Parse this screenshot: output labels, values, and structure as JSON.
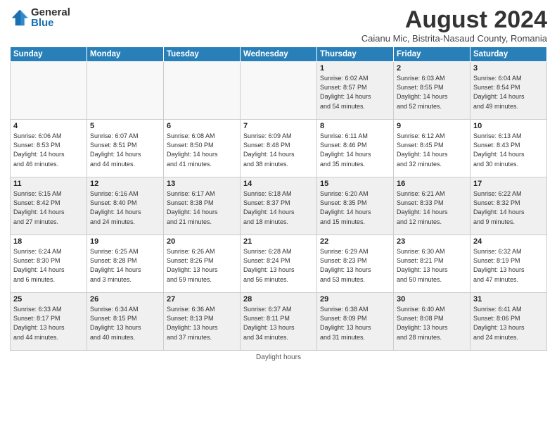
{
  "header": {
    "logo_general": "General",
    "logo_blue": "Blue",
    "month_title": "August 2024",
    "location": "Caianu Mic, Bistrita-Nasaud County, Romania"
  },
  "footer": {
    "daylight_label": "Daylight hours"
  },
  "weekdays": [
    "Sunday",
    "Monday",
    "Tuesday",
    "Wednesday",
    "Thursday",
    "Friday",
    "Saturday"
  ],
  "weeks": [
    [
      {
        "day": "",
        "info": ""
      },
      {
        "day": "",
        "info": ""
      },
      {
        "day": "",
        "info": ""
      },
      {
        "day": "",
        "info": ""
      },
      {
        "day": "1",
        "info": "Sunrise: 6:02 AM\nSunset: 8:57 PM\nDaylight: 14 hours\nand 54 minutes."
      },
      {
        "day": "2",
        "info": "Sunrise: 6:03 AM\nSunset: 8:55 PM\nDaylight: 14 hours\nand 52 minutes."
      },
      {
        "day": "3",
        "info": "Sunrise: 6:04 AM\nSunset: 8:54 PM\nDaylight: 14 hours\nand 49 minutes."
      }
    ],
    [
      {
        "day": "4",
        "info": "Sunrise: 6:06 AM\nSunset: 8:53 PM\nDaylight: 14 hours\nand 46 minutes."
      },
      {
        "day": "5",
        "info": "Sunrise: 6:07 AM\nSunset: 8:51 PM\nDaylight: 14 hours\nand 44 minutes."
      },
      {
        "day": "6",
        "info": "Sunrise: 6:08 AM\nSunset: 8:50 PM\nDaylight: 14 hours\nand 41 minutes."
      },
      {
        "day": "7",
        "info": "Sunrise: 6:09 AM\nSunset: 8:48 PM\nDaylight: 14 hours\nand 38 minutes."
      },
      {
        "day": "8",
        "info": "Sunrise: 6:11 AM\nSunset: 8:46 PM\nDaylight: 14 hours\nand 35 minutes."
      },
      {
        "day": "9",
        "info": "Sunrise: 6:12 AM\nSunset: 8:45 PM\nDaylight: 14 hours\nand 32 minutes."
      },
      {
        "day": "10",
        "info": "Sunrise: 6:13 AM\nSunset: 8:43 PM\nDaylight: 14 hours\nand 30 minutes."
      }
    ],
    [
      {
        "day": "11",
        "info": "Sunrise: 6:15 AM\nSunset: 8:42 PM\nDaylight: 14 hours\nand 27 minutes."
      },
      {
        "day": "12",
        "info": "Sunrise: 6:16 AM\nSunset: 8:40 PM\nDaylight: 14 hours\nand 24 minutes."
      },
      {
        "day": "13",
        "info": "Sunrise: 6:17 AM\nSunset: 8:38 PM\nDaylight: 14 hours\nand 21 minutes."
      },
      {
        "day": "14",
        "info": "Sunrise: 6:18 AM\nSunset: 8:37 PM\nDaylight: 14 hours\nand 18 minutes."
      },
      {
        "day": "15",
        "info": "Sunrise: 6:20 AM\nSunset: 8:35 PM\nDaylight: 14 hours\nand 15 minutes."
      },
      {
        "day": "16",
        "info": "Sunrise: 6:21 AM\nSunset: 8:33 PM\nDaylight: 14 hours\nand 12 minutes."
      },
      {
        "day": "17",
        "info": "Sunrise: 6:22 AM\nSunset: 8:32 PM\nDaylight: 14 hours\nand 9 minutes."
      }
    ],
    [
      {
        "day": "18",
        "info": "Sunrise: 6:24 AM\nSunset: 8:30 PM\nDaylight: 14 hours\nand 6 minutes."
      },
      {
        "day": "19",
        "info": "Sunrise: 6:25 AM\nSunset: 8:28 PM\nDaylight: 14 hours\nand 3 minutes."
      },
      {
        "day": "20",
        "info": "Sunrise: 6:26 AM\nSunset: 8:26 PM\nDaylight: 13 hours\nand 59 minutes."
      },
      {
        "day": "21",
        "info": "Sunrise: 6:28 AM\nSunset: 8:24 PM\nDaylight: 13 hours\nand 56 minutes."
      },
      {
        "day": "22",
        "info": "Sunrise: 6:29 AM\nSunset: 8:23 PM\nDaylight: 13 hours\nand 53 minutes."
      },
      {
        "day": "23",
        "info": "Sunrise: 6:30 AM\nSunset: 8:21 PM\nDaylight: 13 hours\nand 50 minutes."
      },
      {
        "day": "24",
        "info": "Sunrise: 6:32 AM\nSunset: 8:19 PM\nDaylight: 13 hours\nand 47 minutes."
      }
    ],
    [
      {
        "day": "25",
        "info": "Sunrise: 6:33 AM\nSunset: 8:17 PM\nDaylight: 13 hours\nand 44 minutes."
      },
      {
        "day": "26",
        "info": "Sunrise: 6:34 AM\nSunset: 8:15 PM\nDaylight: 13 hours\nand 40 minutes."
      },
      {
        "day": "27",
        "info": "Sunrise: 6:36 AM\nSunset: 8:13 PM\nDaylight: 13 hours\nand 37 minutes."
      },
      {
        "day": "28",
        "info": "Sunrise: 6:37 AM\nSunset: 8:11 PM\nDaylight: 13 hours\nand 34 minutes."
      },
      {
        "day": "29",
        "info": "Sunrise: 6:38 AM\nSunset: 8:09 PM\nDaylight: 13 hours\nand 31 minutes."
      },
      {
        "day": "30",
        "info": "Sunrise: 6:40 AM\nSunset: 8:08 PM\nDaylight: 13 hours\nand 28 minutes."
      },
      {
        "day": "31",
        "info": "Sunrise: 6:41 AM\nSunset: 8:06 PM\nDaylight: 13 hours\nand 24 minutes."
      }
    ]
  ]
}
